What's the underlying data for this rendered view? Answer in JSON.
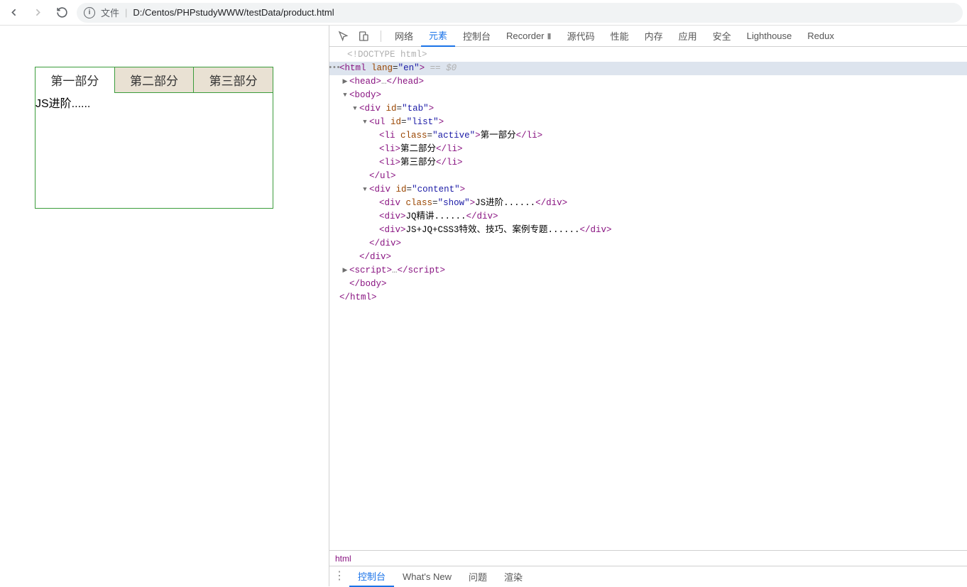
{
  "browser": {
    "file_label": "文件",
    "url": "D:/Centos/PHPstudyWWW/testData/product.html"
  },
  "demo": {
    "tabs": [
      "第一部分",
      "第二部分",
      "第三部分"
    ],
    "content": "JS进阶......"
  },
  "devtools": {
    "tabs": {
      "network": "网络",
      "elements": "元素",
      "console": "控制台",
      "recorder": "Recorder",
      "sources": "源代码",
      "performance": "性能",
      "memory": "内存",
      "application": "应用",
      "security": "安全",
      "lighthouse": "Lighthouse",
      "redux": "Redux"
    },
    "tree": {
      "doctype": "<!DOCTYPE html>",
      "html_open": "<html lang=\"en\">",
      "sel_marker": "== $0",
      "head": {
        "open": "<head>",
        "ell": "…",
        "close": "</head>"
      },
      "body_open": "<body>",
      "div_tab": "<div id=\"tab\">",
      "ul_list": "<ul id=\"list\">",
      "li1": {
        "open": "<li class=\"active\">",
        "t": "第一部分",
        "close": "</li>"
      },
      "li2": {
        "open": "<li>",
        "t": "第二部分",
        "close": "</li>"
      },
      "li3": {
        "open": "<li>",
        "t": "第三部分",
        "close": "</li>"
      },
      "ul_close": "</ul>",
      "div_content": "<div id=\"content\">",
      "c1": {
        "open": "<div class=\"show\">",
        "t": "JS进阶......",
        "close": "</div>"
      },
      "c2": {
        "open": "<div>",
        "t": "JQ精讲......",
        "close": "</div>"
      },
      "c3": {
        "open": "<div>",
        "t": "JS+JQ+CSS3特效、技巧、案例专题......",
        "close": "</div>"
      },
      "div_close1": "</div>",
      "div_close2": "</div>",
      "script": {
        "open": "<script>",
        "ell": "…",
        "close": "</script>"
      },
      "body_close": "</body>",
      "html_close": "</html>"
    },
    "breadcrumb": "html",
    "drawer": {
      "console": "控制台",
      "whatsnew": "What's New",
      "issues": "问题",
      "rendering": "渲染"
    }
  }
}
